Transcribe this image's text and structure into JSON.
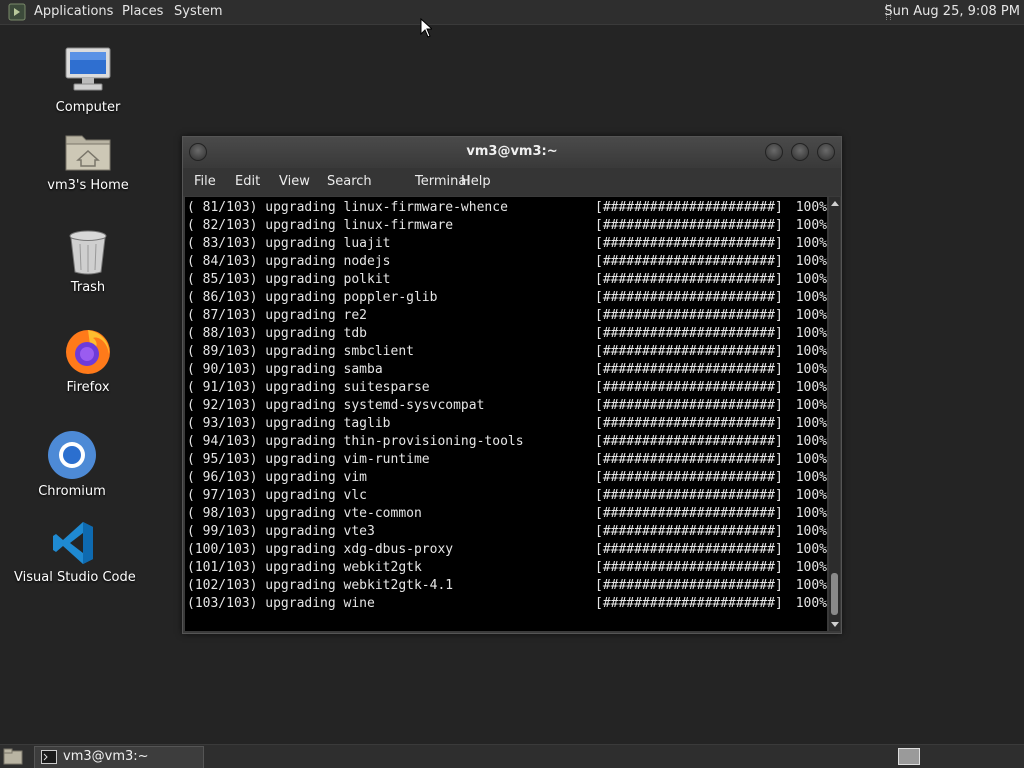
{
  "top_panel": {
    "menus": [
      "Applications",
      "Places",
      "System"
    ],
    "clock": "Sun Aug 25,  9:08 PM"
  },
  "desktop": {
    "icons": [
      {
        "label": "Computer",
        "icon": "computer-icon"
      },
      {
        "label": "vm3's Home",
        "icon": "home-folder-icon"
      },
      {
        "label": "Trash",
        "icon": "trash-icon"
      },
      {
        "label": "Firefox",
        "icon": "firefox-icon"
      },
      {
        "label": "Chromium",
        "icon": "chromium-icon"
      },
      {
        "label": "Visual Studio Code",
        "icon": "vscode-icon"
      }
    ]
  },
  "terminal": {
    "title": "vm3@vm3:~",
    "menu": [
      "File",
      "Edit",
      "View",
      "Search",
      "Terminal",
      "Help"
    ],
    "progress_bar": "[######################]",
    "lines": [
      {
        "prefix": "( 81/103) upgrading linux-firmware-whence",
        "percent": "100%"
      },
      {
        "prefix": "( 82/103) upgrading linux-firmware",
        "percent": "100%"
      },
      {
        "prefix": "( 83/103) upgrading luajit",
        "percent": "100%"
      },
      {
        "prefix": "( 84/103) upgrading nodejs",
        "percent": "100%"
      },
      {
        "prefix": "( 85/103) upgrading polkit",
        "percent": "100%"
      },
      {
        "prefix": "( 86/103) upgrading poppler-glib",
        "percent": "100%"
      },
      {
        "prefix": "( 87/103) upgrading re2",
        "percent": "100%"
      },
      {
        "prefix": "( 88/103) upgrading tdb",
        "percent": "100%"
      },
      {
        "prefix": "( 89/103) upgrading smbclient",
        "percent": "100%"
      },
      {
        "prefix": "( 90/103) upgrading samba",
        "percent": "100%"
      },
      {
        "prefix": "( 91/103) upgrading suitesparse",
        "percent": "100%"
      },
      {
        "prefix": "( 92/103) upgrading systemd-sysvcompat",
        "percent": "100%"
      },
      {
        "prefix": "( 93/103) upgrading taglib",
        "percent": "100%"
      },
      {
        "prefix": "( 94/103) upgrading thin-provisioning-tools",
        "percent": "100%"
      },
      {
        "prefix": "( 95/103) upgrading vim-runtime",
        "percent": "100%"
      },
      {
        "prefix": "( 96/103) upgrading vim",
        "percent": "100%"
      },
      {
        "prefix": "( 97/103) upgrading vlc",
        "percent": "100%"
      },
      {
        "prefix": "( 98/103) upgrading vte-common",
        "percent": "100%"
      },
      {
        "prefix": "( 99/103) upgrading vte3",
        "percent": "100%"
      },
      {
        "prefix": "(100/103) upgrading xdg-dbus-proxy",
        "percent": "100%"
      },
      {
        "prefix": "(101/103) upgrading webkit2gtk",
        "percent": "100%"
      },
      {
        "prefix": "(102/103) upgrading webkit2gtk-4.1",
        "percent": "100%"
      },
      {
        "prefix": "(103/103) upgrading wine",
        "percent": "100%"
      }
    ]
  },
  "taskbar": {
    "items": [
      {
        "label": "vm3@vm3:~",
        "icon": "terminal-icon"
      }
    ]
  },
  "colors": {
    "desktop_bg": "#242424",
    "panel_bg": "#2e2e2e",
    "terminal_bg": "#000000",
    "terminal_fg": "#e6e6e6"
  }
}
